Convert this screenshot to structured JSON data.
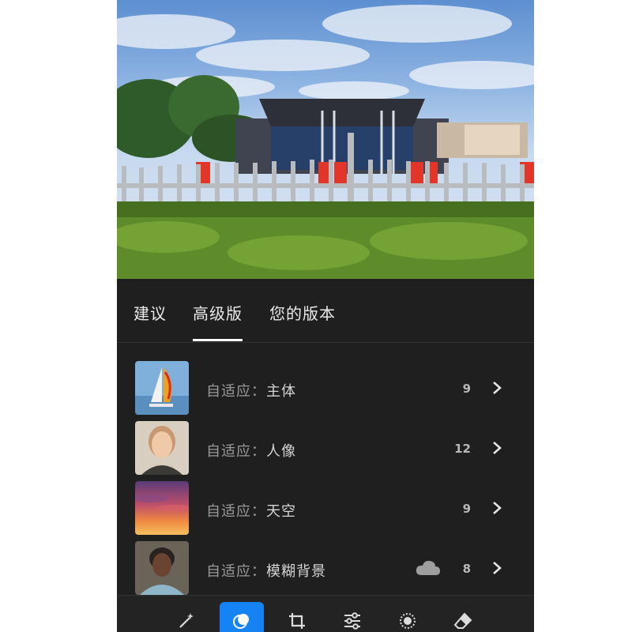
{
  "tabs": [
    {
      "label": "建议",
      "active": false
    },
    {
      "label": "高级版",
      "active": true
    },
    {
      "label": "您的版本",
      "active": false
    }
  ],
  "presets": [
    {
      "prefix": "自适应：",
      "name": "主体",
      "count": "9",
      "thumb": "sailboat",
      "cloud": false
    },
    {
      "prefix": "自适应：",
      "name": "人像",
      "count": "12",
      "thumb": "portrait-woman",
      "cloud": false
    },
    {
      "prefix": "自适应：",
      "name": "天空",
      "count": "9",
      "thumb": "sunset-sky",
      "cloud": false
    },
    {
      "prefix": "自适应：",
      "name": "模糊背景",
      "count": "8",
      "thumb": "portrait-man",
      "cloud": true
    }
  ],
  "toolbar": {
    "tools": [
      "auto-magic-wand-icon",
      "presets-icon",
      "crop-icon",
      "adjust-sliders-icon",
      "effects-icon",
      "eraser-icon"
    ],
    "active_tool": "presets-icon"
  },
  "colors": {
    "panel_bg": "#1f1f1f",
    "accent": "#1683f5",
    "tab_text": "#eaeaea",
    "row_label": "#9a9a9a"
  }
}
